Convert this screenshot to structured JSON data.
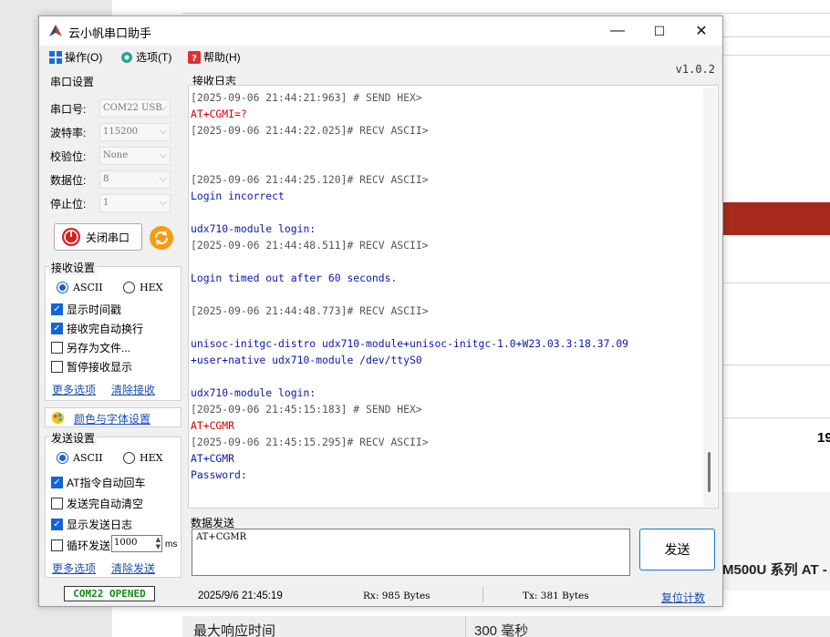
{
  "window": {
    "title": "云小帆串口助手",
    "version": "v1.0.2",
    "controls": {
      "minimize": "—",
      "maximize": "☐",
      "close": "✕"
    }
  },
  "menu": [
    {
      "label": "操作(O)",
      "icon": "grid-icon"
    },
    {
      "label": "选项(T)",
      "icon": "gear-icon"
    },
    {
      "label": "帮助(H)",
      "icon": "help-icon"
    }
  ],
  "serial": {
    "legend": "串口设置",
    "fields": [
      {
        "label": "串口号:",
        "value": "COM22 USB"
      },
      {
        "label": "波特率:",
        "value": "115200"
      },
      {
        "label": "校验位:",
        "value": "None"
      },
      {
        "label": "数据位:",
        "value": "8"
      },
      {
        "label": "停止位:",
        "value": "1"
      }
    ],
    "close_button": "关闭串口"
  },
  "receive": {
    "legend": "接收设置",
    "ascii": "ASCII",
    "hex": "HEX",
    "options": [
      {
        "label": "显示时间戳",
        "checked": true
      },
      {
        "label": "接收完自动换行",
        "checked": true
      },
      {
        "label": "另存为文件...",
        "checked": false
      },
      {
        "label": "暂停接收显示",
        "checked": false
      }
    ],
    "more": "更多选项",
    "clear": "清除接收"
  },
  "color_setting": "颜色与字体设置",
  "send": {
    "legend": "发送设置",
    "ascii": "ASCII",
    "hex": "HEX",
    "options": [
      {
        "label": "AT指令自动回车",
        "checked": true
      },
      {
        "label": "发送完自动清空",
        "checked": false
      },
      {
        "label": "显示发送日志",
        "checked": true
      }
    ],
    "loop_label": "循环发送",
    "loop_checked": false,
    "loop_value": "1000",
    "loop_unit": "ms",
    "more": "更多选项",
    "clear": "清除发送"
  },
  "log": {
    "legend": "接收日志",
    "lines": [
      {
        "text": "[2025-09-06 21:44:21:963] # SEND HEX>",
        "kind": "t"
      },
      {
        "text": "AT+CGMI=?",
        "kind": "s"
      },
      {
        "text": "[2025-09-06 21:44:22.025]# RECV ASCII>",
        "kind": "t"
      },
      {
        "text": "",
        "kind": "r"
      },
      {
        "text": "",
        "kind": "r"
      },
      {
        "text": "[2025-09-06 21:44:25.120]# RECV ASCII>",
        "kind": "t"
      },
      {
        "text": "Login incorrect",
        "kind": "r"
      },
      {
        "text": "",
        "kind": "r"
      },
      {
        "text": "udx710-module login:",
        "kind": "r"
      },
      {
        "text": "[2025-09-06 21:44:48.511]# RECV ASCII>",
        "kind": "t"
      },
      {
        "text": "",
        "kind": "r"
      },
      {
        "text": "Login timed out after 60 seconds.",
        "kind": "r"
      },
      {
        "text": "",
        "kind": "r"
      },
      {
        "text": "[2025-09-06 21:44:48.773]# RECV ASCII>",
        "kind": "t"
      },
      {
        "text": "",
        "kind": "r"
      },
      {
        "text": "unisoc-initgc-distro udx710-module+unisoc-initgc-1.0+W23.03.3:18.37.09",
        "kind": "r"
      },
      {
        "text": "+user+native udx710-module /dev/ttyS0",
        "kind": "r"
      },
      {
        "text": "",
        "kind": "r"
      },
      {
        "text": "udx710-module login:",
        "kind": "r"
      },
      {
        "text": "[2025-09-06 21:45:15:183] # SEND HEX>",
        "kind": "t"
      },
      {
        "text": "AT+CGMR",
        "kind": "s"
      },
      {
        "text": "[2025-09-06 21:45:15.295]# RECV ASCII>",
        "kind": "t"
      },
      {
        "text": "AT+CGMR",
        "kind": "r"
      },
      {
        "text": "Password:",
        "kind": "r"
      }
    ]
  },
  "data_send": {
    "legend": "数据发送",
    "value": "AT+CGMR",
    "button": "发送"
  },
  "statusbar": {
    "port": "COM22 OPENED",
    "time": "2025/9/6 21:45:19",
    "rx": "Rx: 985 Bytes",
    "tx": "Tx: 381 Bytes",
    "reset": "复位计数"
  },
  "background": {
    "number": "19",
    "series": "M500U 系列 AT -",
    "row_label": "最大响应时间",
    "row_value": "300 毫秒"
  },
  "colors": {
    "send_text": "#d00000",
    "recv_text": "#0b18a8",
    "accent": "#1464d2",
    "port_open": "#138a13",
    "bg_red_bar": "#a92a1c"
  }
}
